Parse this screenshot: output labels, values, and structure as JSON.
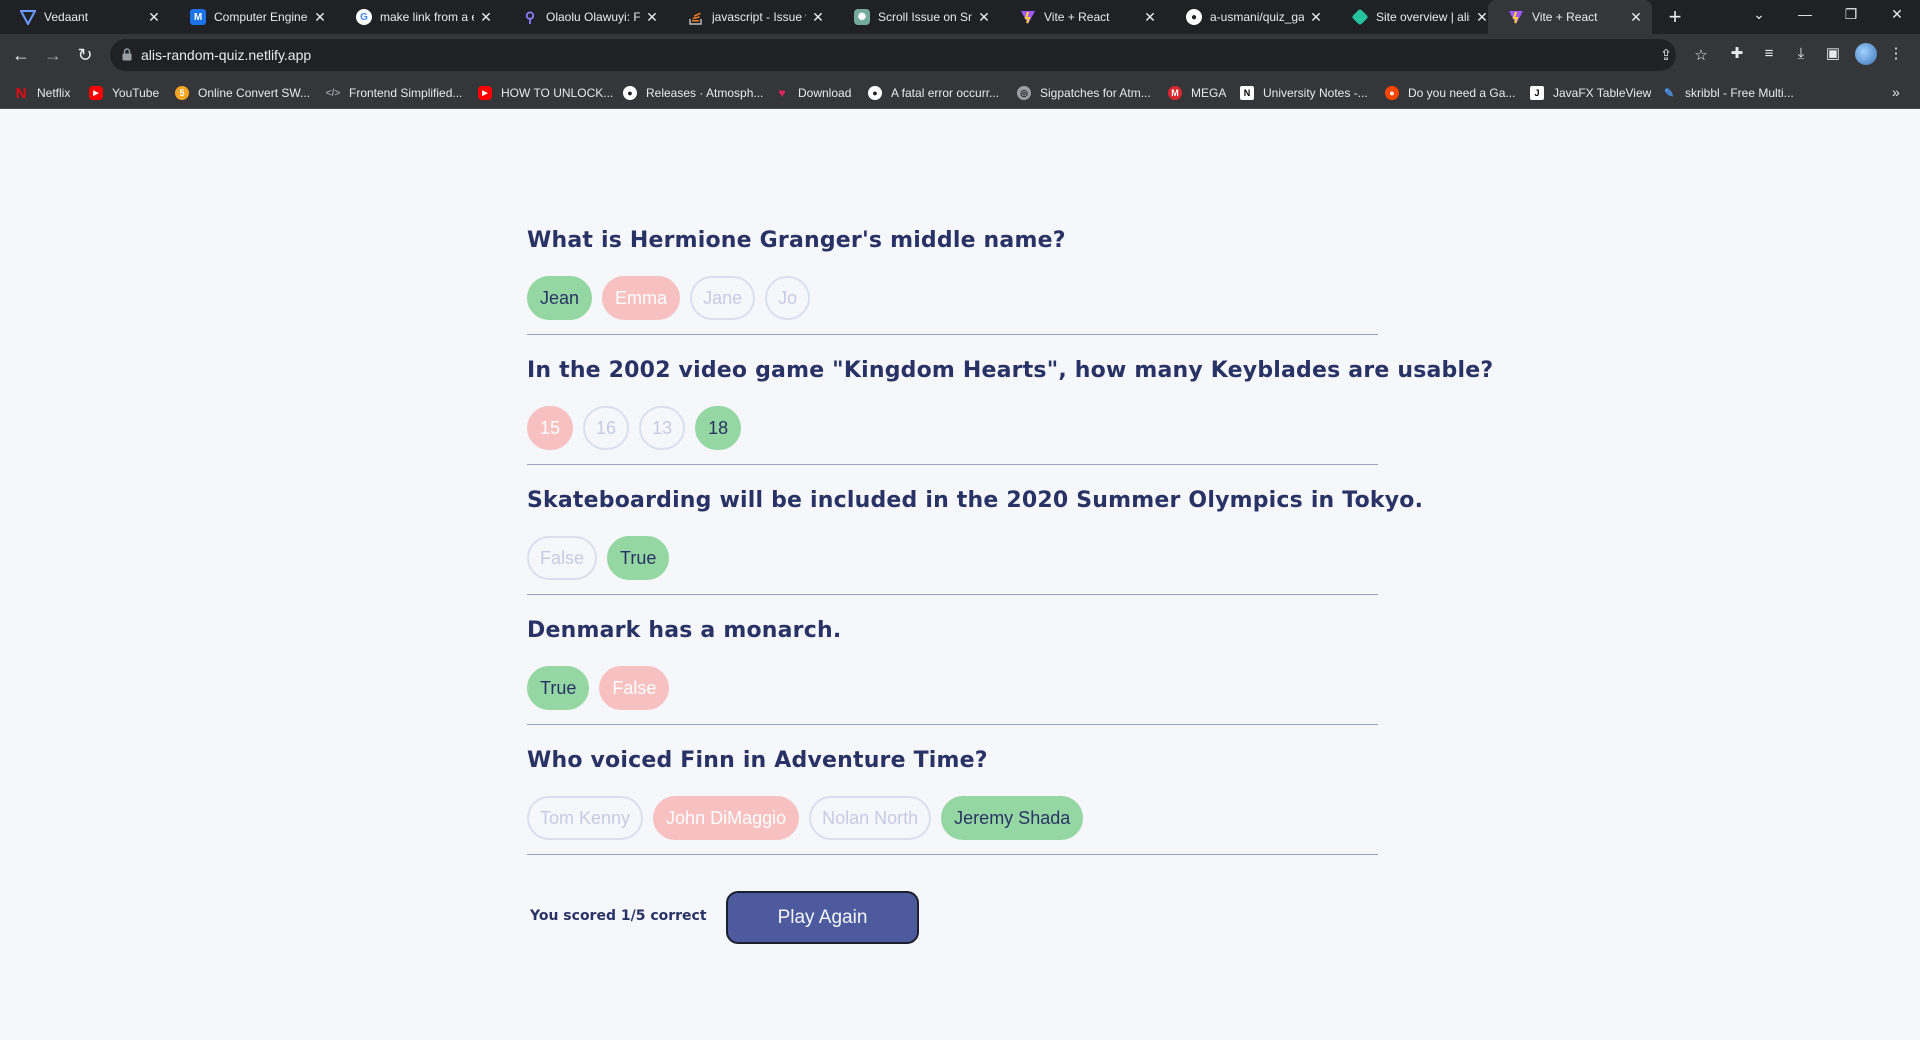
{
  "browser": {
    "tabs": [
      {
        "title": "Vedaant",
        "icon": "vite-icon",
        "color": "#3b6fd8"
      },
      {
        "title": "Computer Enginee",
        "icon": "m-icon",
        "color": "#1a73e8"
      },
      {
        "title": "make link from a e",
        "icon": "google-icon",
        "color": "#ffffff"
      },
      {
        "title": "Olaolu Olawuyi: Fr",
        "icon": "pin-icon",
        "color": "#7b5cff"
      },
      {
        "title": "javascript - Issue w",
        "icon": "stackoverflow-icon",
        "color": "#f48024"
      },
      {
        "title": "Scroll Issue on Sm",
        "icon": "chatgpt-icon",
        "color": "#74aa9c"
      },
      {
        "title": "Vite + React",
        "icon": "vite-icon",
        "color": "#a259ff"
      },
      {
        "title": "a-usmani/quiz_gan",
        "icon": "github-icon",
        "color": "#ffffff"
      },
      {
        "title": "Site overview | alis",
        "icon": "netlify-icon",
        "color": "#25c2a0"
      },
      {
        "title": "Vite + React",
        "icon": "vite-icon",
        "color": "#a259ff"
      }
    ],
    "new_tab_label": "+",
    "url": "alis-random-quiz.netlify.app",
    "bookmarks": [
      {
        "label": "Netflix",
        "icon": "netflix-icon",
        "color": "#e50914"
      },
      {
        "label": "YouTube",
        "icon": "youtube-icon",
        "color": "#ff0000"
      },
      {
        "label": "Online Convert SW...",
        "icon": "convert-icon",
        "color": "#f5a623"
      },
      {
        "label": "Frontend Simplified...",
        "icon": "code-icon",
        "color": "#9aa0a6"
      },
      {
        "label": "HOW TO UNLOCK...",
        "icon": "youtube-icon",
        "color": "#ff0000"
      },
      {
        "label": "Releases · Atmosph...",
        "icon": "github-icon",
        "color": "#ffffff"
      },
      {
        "label": "Download",
        "icon": "heart-icon",
        "color": "#e0245e"
      },
      {
        "label": "A fatal error occurr...",
        "icon": "github-icon",
        "color": "#ffffff"
      },
      {
        "label": "Sigpatches for Atm...",
        "icon": "gbatemp-icon",
        "color": "#9aa0a6"
      },
      {
        "label": "MEGA",
        "icon": "mega-icon",
        "color": "#d9272e"
      },
      {
        "label": "University Notes -...",
        "icon": "notion-icon",
        "color": "#ffffff"
      },
      {
        "label": "Do you need a Ga...",
        "icon": "reddit-icon",
        "color": "#ff4500"
      },
      {
        "label": "JavaFX TableView",
        "icon": "j-icon",
        "color": "#000000"
      },
      {
        "label": "skribbl - Free Multi...",
        "icon": "pencil-icon",
        "color": "#4a90e2"
      }
    ]
  },
  "quiz": {
    "colors": {
      "correct": "#94D7A2",
      "wrong": "#F8BCBC",
      "text": "#293264",
      "button": "#4D5B9E"
    },
    "questions": [
      {
        "text": "What is Hermione Granger's middle name?",
        "answers": [
          {
            "label": "Jean",
            "state": "correct"
          },
          {
            "label": "Emma",
            "state": "wrong"
          },
          {
            "label": "Jane",
            "state": "neutral"
          },
          {
            "label": "Jo",
            "state": "neutral"
          }
        ]
      },
      {
        "text": "In the 2002 video game \"Kingdom Hearts\", how many Keyblades are usable?",
        "answers": [
          {
            "label": "15",
            "state": "wrong"
          },
          {
            "label": "16",
            "state": "neutral"
          },
          {
            "label": "13",
            "state": "neutral"
          },
          {
            "label": "18",
            "state": "correct"
          }
        ]
      },
      {
        "text": "Skateboarding will be included in the 2020 Summer Olympics in Tokyo.",
        "answers": [
          {
            "label": "False",
            "state": "neutral"
          },
          {
            "label": "True",
            "state": "correct"
          }
        ]
      },
      {
        "text": "Denmark has a monarch.",
        "answers": [
          {
            "label": "True",
            "state": "correct"
          },
          {
            "label": "False",
            "state": "wrong"
          }
        ]
      },
      {
        "text": "Who voiced Finn in Adventure Time?",
        "answers": [
          {
            "label": "Tom Kenny",
            "state": "neutral"
          },
          {
            "label": "John DiMaggio",
            "state": "wrong"
          },
          {
            "label": "Nolan North",
            "state": "neutral"
          },
          {
            "label": "Jeremy Shada",
            "state": "correct"
          }
        ]
      }
    ],
    "score_text": "You scored 1/5 correct",
    "play_again_label": "Play Again"
  }
}
